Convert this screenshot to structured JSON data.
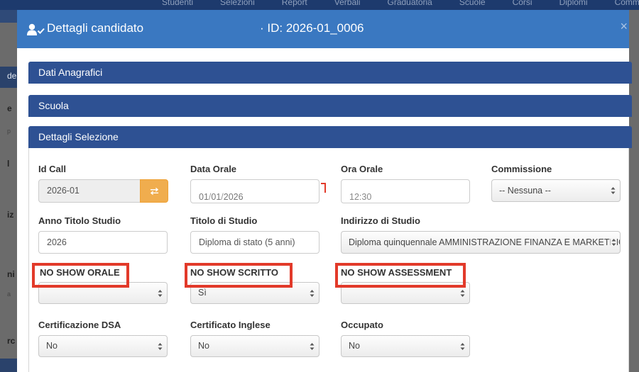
{
  "background": {
    "nav_items": [
      "Studenti",
      "Selezioni",
      "Report",
      "Verbali",
      "Graduatoria",
      "Scuole",
      "Corsi",
      "Diplomi",
      "Commissioni"
    ],
    "left_fragments": [
      "de",
      "e",
      "p",
      "l",
      "iz",
      "ni",
      "a",
      "rc"
    ]
  },
  "modal": {
    "title": "Dettagli candidato",
    "candidate_id": "· ID: 2026-01_0006",
    "close_label": "×"
  },
  "panels": {
    "anagrafici": "Dati Anagrafici",
    "scuola": "Scuola",
    "selezione": "Dettagli Selezione"
  },
  "form": {
    "id_call": {
      "label": "Id Call",
      "value": "2026-01"
    },
    "data_orale": {
      "label": "Data Orale",
      "day": "01",
      "month": "01",
      "year": "2026"
    },
    "ora_orale": {
      "label": "Ora Orale",
      "hour": "12",
      "minute": "30"
    },
    "commissione": {
      "label": "Commissione",
      "value": "-- Nessuna --"
    },
    "anno_titolo": {
      "label": "Anno Titolo Studio",
      "value": "2026"
    },
    "titolo_studio": {
      "label": "Titolo di Studio",
      "value": "Diploma di stato (5 anni)"
    },
    "indirizzo_studio": {
      "label": "Indirizzo di Studio",
      "value": "Diploma quinquennale AMMINISTRAZIONE FINANZA E MARKETING"
    },
    "no_show_orale": {
      "label": "NO SHOW ORALE",
      "value": ""
    },
    "no_show_scritto": {
      "label": "NO SHOW SCRITTO",
      "value": "Sì"
    },
    "no_show_assessment": {
      "label": "NO SHOW ASSESSMENT",
      "value": ""
    },
    "cert_dsa": {
      "label": "Certificazione DSA",
      "value": "No"
    },
    "cert_inglese": {
      "label": "Certificato Inglese",
      "value": "No"
    },
    "occupato": {
      "label": "Occupato",
      "value": "No"
    }
  },
  "colors": {
    "header": "#3a78c1",
    "panel": "#2e5193",
    "addon": "#f0ad4e",
    "highlight": "#e23a2a"
  }
}
